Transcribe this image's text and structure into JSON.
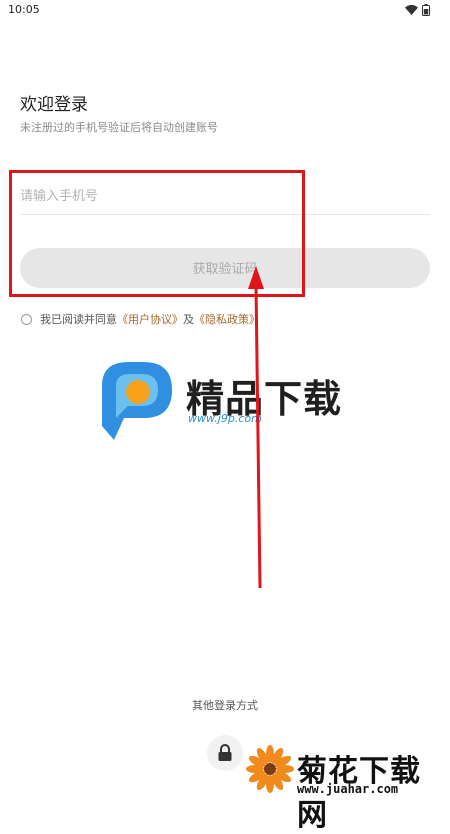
{
  "status_bar": {
    "time": "10:05"
  },
  "login": {
    "title": "欢迎登录",
    "subtitle": "未注册过的手机号验证后将自动创建账号",
    "phone_placeholder": "请输入手机号",
    "get_code_label": "获取验证码",
    "agreement": {
      "prefix": "我已阅读并同意",
      "user_agreement": "《用户协议》",
      "conjunction": "及",
      "privacy_policy": "《隐私政策》"
    },
    "other_methods_label": "其他登录方式"
  },
  "watermarks": {
    "top_brand": "精品下载",
    "top_url": "www.j9p.com",
    "bottom_brand": "菊花下载网",
    "bottom_url": "www.juahar.com"
  },
  "colors": {
    "annotation_red": "#e0151b",
    "link": "#a46a2f",
    "button_disabled": "#e6e6e6"
  }
}
